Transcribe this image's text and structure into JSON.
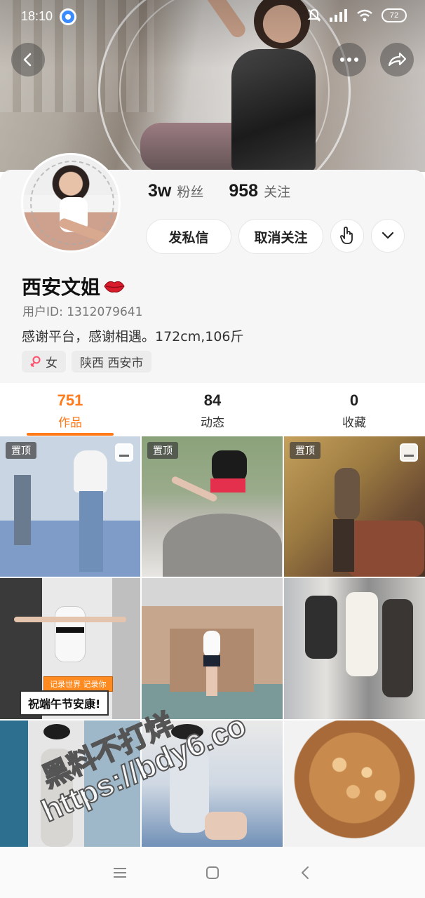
{
  "status": {
    "time": "18:10",
    "battery": "72"
  },
  "profile": {
    "followers_count": "3w",
    "followers_label": "粉丝",
    "following_count": "958",
    "following_label": "关注",
    "message_button": "发私信",
    "unfollow_button": "取消关注",
    "name": "西安文姐",
    "user_id": "用户ID: 1312079641",
    "bio": "感谢平台，感谢相遇。172cm,106斤",
    "gender": "女",
    "location": "陕西 西安市"
  },
  "tabs": [
    {
      "count": "751",
      "label": "作品",
      "active": true
    },
    {
      "count": "84",
      "label": "动态",
      "active": false
    },
    {
      "count": "0",
      "label": "收藏",
      "active": false
    }
  ],
  "grid": {
    "pinned_label": "置顶",
    "item4_banner": "记录世界 记录你",
    "item4_caption": "祝端午节安康!"
  },
  "watermark": {
    "line1": "黑料不打烊",
    "line2": "https://bdy6.co"
  },
  "colors": {
    "accent": "#ff7a1a",
    "background": "#f6f6f6"
  },
  "icons": {
    "back": "chevron-left-icon",
    "more": "more-dots-icon",
    "share": "share-arrow-icon",
    "hand": "hand-pointer-icon",
    "dropdown": "chevron-down-icon"
  }
}
